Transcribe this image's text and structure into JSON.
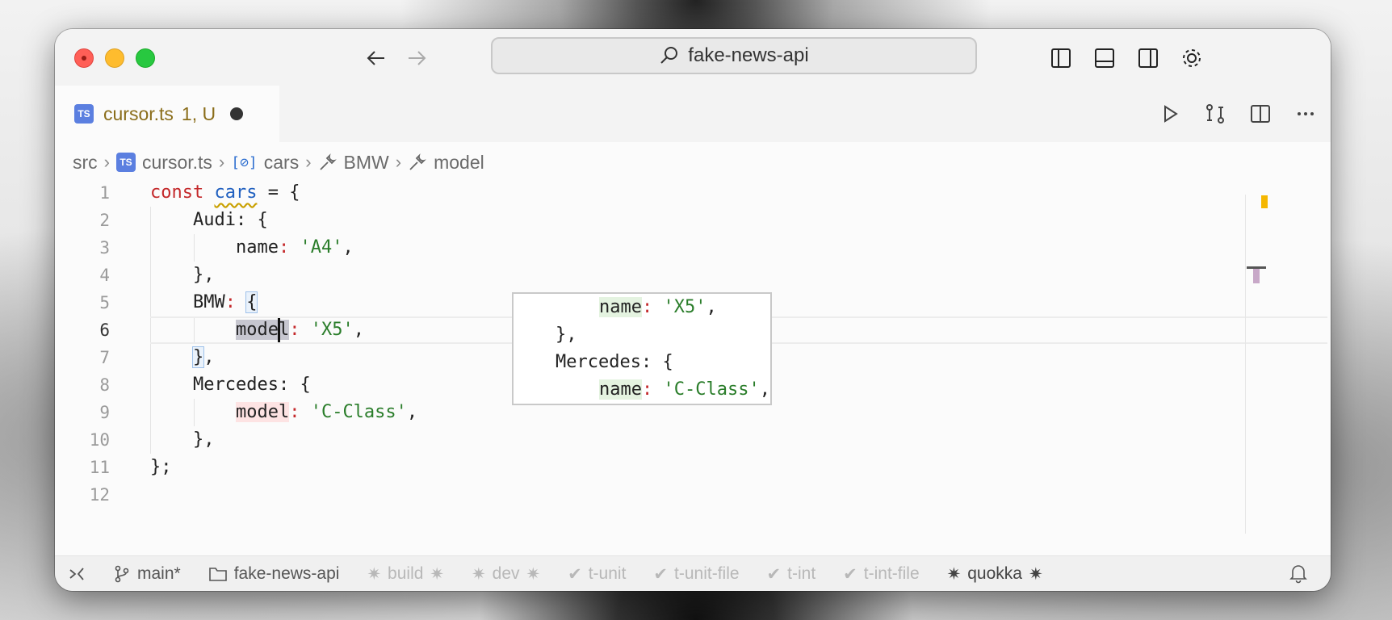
{
  "search": {
    "label": "fake-news-api"
  },
  "tab": {
    "name": "cursor.ts",
    "status": "1, U",
    "badge": "TS"
  },
  "breadcrumb": [
    "src",
    "cursor.ts",
    "cars",
    "BMW",
    "model"
  ],
  "editor": {
    "line_numbers": [
      "1",
      "2",
      "3",
      "4",
      "5",
      "6",
      "7",
      "8",
      "9",
      "10",
      "11",
      "12"
    ],
    "code": {
      "l1_kw": "const",
      "l1_var": "cars",
      "l1_rest": " = {",
      "l2": "Audi",
      "l2_rest": ": {",
      "l3_key": "name",
      "l3_val": "'A4'",
      "l4": "},",
      "l5": "BMW",
      "l5_colon": ": ",
      "l5_brace": "{",
      "l6_key_a": "mode",
      "l6_key_b": "l",
      "l6_val": "'X5'",
      "l7_brace": "}",
      "l7_comma": ",",
      "l8": "Mercedes",
      "l8_rest": ": {",
      "l9_key": "model",
      "l9_val": "'C-Class'",
      "l10": "},",
      "l11": "};"
    },
    "peek": {
      "p1_key": "name",
      "p1_val": "'X5'",
      "p2": "},",
      "p3": "Mercedes",
      "p3_rest": ": {",
      "p4_key": "name",
      "p4_val": "'C-Class'"
    }
  },
  "statusbar": {
    "branch": "main*",
    "folder": "fake-news-api",
    "items": [
      "build",
      "dev",
      "t-unit",
      "t-unit-file",
      "t-int",
      "t-int-file"
    ],
    "quokka": "quokka"
  },
  "colors": {
    "ts_badge": "#5b7fe0",
    "keyword": "#c4292b",
    "string": "#2a7d2a",
    "variable": "#2060c0",
    "modified_tab": "#8a6d1a"
  }
}
